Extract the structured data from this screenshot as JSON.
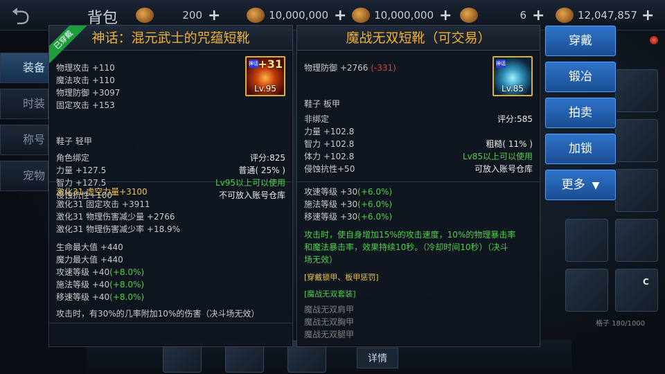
{
  "topbar": {
    "title": "背包",
    "currencies": [
      {
        "icon": "spoon-icon",
        "value": "200"
      },
      {
        "icon": "gold-coin-icon",
        "value": "10,000,000"
      },
      {
        "icon": "gold-pot-icon",
        "value": "10,000,000"
      },
      {
        "icon": "gem-icon",
        "value": "6"
      },
      {
        "icon": "coin-stack-icon",
        "value": "12,047,857"
      }
    ]
  },
  "side_tabs": [
    "装备",
    "时装",
    "称号",
    "宠物"
  ],
  "background": {
    "detail_label": "详情",
    "capacity": "格子 180/1000",
    "c_label": "C"
  },
  "left_item": {
    "equipped_badge": "已穿戴",
    "title": "神话：混元武士的咒蕴短靴",
    "icon_tag": "神话",
    "enhance": "+31",
    "level_badge": "Lv.95",
    "base_stats": [
      "物理攻击 +110",
      "魔法攻击 +110",
      "物理防御 +3097",
      "固定攻击 +153"
    ],
    "type": "鞋子 轻甲",
    "bind": "角色绑定",
    "score": "评分:825",
    "stat_rows": [
      {
        "left": "力量 +127.5",
        "right": "普通( 25% )"
      },
      {
        "left": "智力 +127.5",
        "right": "Lv95以上可以使用"
      },
      {
        "left": "侵蚀抗性+100",
        "right": "不可放入账号仓库"
      }
    ],
    "enhance_lines": [
      "激化31 虚空力量+3100",
      "激化31 固定攻击 +3911",
      "激化31 物理伤害减少量 +2766",
      "激化31 物理伤害减少率 +18.9%"
    ],
    "extra_lines": [
      {
        "text": "生命最大值 +440",
        "bonus": ""
      },
      {
        "text": "魔力最大值 +440",
        "bonus": ""
      },
      {
        "text": "攻速等级 +40",
        "bonus": "(+8.0%)"
      },
      {
        "text": "施法等级 +40",
        "bonus": "(+8.0%)"
      },
      {
        "text": "移速等级 +40",
        "bonus": "(+8.0%)"
      }
    ],
    "cut_line": "攻击时，有30%的几率附加10%的伤害（决斗场无效）"
  },
  "right_item": {
    "title": "魔战无双短靴（可交易）",
    "icon_tag": "神话",
    "level_badge": "Lv.85",
    "def_stat": "物理防御 +2766",
    "def_diff": "(-331)",
    "type": "鞋子 板甲",
    "bind": "非绑定",
    "score": "评分:585",
    "stat_rows": [
      {
        "left": "力量 +102.8",
        "right": ""
      },
      {
        "left": "智力 +102.8",
        "right": "粗糙( 11% )"
      },
      {
        "left": "体力 +102.8",
        "right": "Lv85以上可以使用"
      },
      {
        "left": "侵蚀抗性+50",
        "right": "可放入账号仓库"
      }
    ],
    "speed_lines": [
      {
        "text": "攻速等级 +30",
        "bonus": "(+6.0%)"
      },
      {
        "text": "施法等级 +30",
        "bonus": "(+6.0%)"
      },
      {
        "text": "移速等级 +30",
        "bonus": "(+6.0%)"
      }
    ],
    "effect": [
      "攻击时，使自身增加15%的攻击速度，10%的物理暴击率",
      "和魔法暴击率，效果持续10秒。（冷却时间10秒）（决斗",
      "场无效）"
    ],
    "set_tag_1": "[穿戴锁甲、板甲惩罚]",
    "set_name": "[魔战无双套装]",
    "set_pieces": [
      "魔战无双肩甲",
      "魔战无双胸甲",
      "魔战无双腿甲"
    ]
  },
  "actions": {
    "equip": "穿戴",
    "forge": "锻冶",
    "auction": "拍卖",
    "lock": "加锁",
    "more": "更多",
    "more_arrow": "▼"
  }
}
